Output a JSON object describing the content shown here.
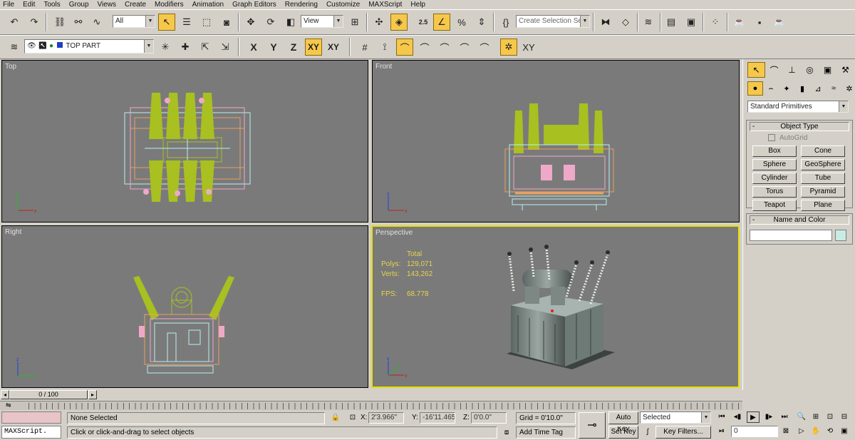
{
  "menu": [
    "File",
    "Edit",
    "Tools",
    "Group",
    "Views",
    "Create",
    "Modifiers",
    "Animation",
    "Graph Editors",
    "Rendering",
    "Customize",
    "MAXScript",
    "Help"
  ],
  "toolbar": {
    "selection_filter": "All",
    "ref_coord": "View",
    "named_selection_placeholder": "Create Selection Set",
    "snap_label": "2.5"
  },
  "layer": {
    "name": "TOP PART"
  },
  "axis_constraints": [
    "X",
    "Y",
    "Z",
    "XY",
    "XY"
  ],
  "viewports": {
    "top": "Top",
    "front": "Front",
    "right": "Right",
    "perspective": "Perspective"
  },
  "stats": {
    "header": "Total",
    "polys_label": "Polys:",
    "polys": "129,071",
    "verts_label": "Verts:",
    "verts": "143,262",
    "fps_label": "FPS:",
    "fps": "68.778"
  },
  "command_panel": {
    "category": "Standard Primitives",
    "object_type_title": "Object Type",
    "autogrid": "AutoGrid",
    "objects": [
      "Box",
      "Cone",
      "Sphere",
      "GeoSphere",
      "Cylinder",
      "Tube",
      "Torus",
      "Pyramid",
      "Teapot",
      "Plane"
    ],
    "name_color_title": "Name and Color",
    "object_color": "#c8ece4"
  },
  "time": {
    "slider": "0 / 100"
  },
  "status": {
    "selection": "None Selected",
    "prompt": "Click or click-and-drag to select objects",
    "maxscript": "MAXScript.",
    "x_label": "X:",
    "x": "2'3.966\"",
    "y_label": "Y:",
    "y": "-16'11.465\"",
    "z_label": "Z:",
    "z": "0'0.0\"",
    "grid": "Grid = 0'10.0\"",
    "add_time_tag": "Add Time Tag",
    "auto_key": "Auto Key",
    "set_key": "Set Key",
    "key_mode": "Selected",
    "key_filters": "Key Filters...",
    "frame": "0"
  },
  "colors": {
    "viewport_bg": "#7a7a7a",
    "active_border": "#e8e000",
    "bushing": "#a8c020",
    "frame_pink": "#f0a8c8",
    "frame_orange": "#e8a060",
    "frame_cyan": "#b8f0f0",
    "stats_text": "#e8d44a"
  }
}
